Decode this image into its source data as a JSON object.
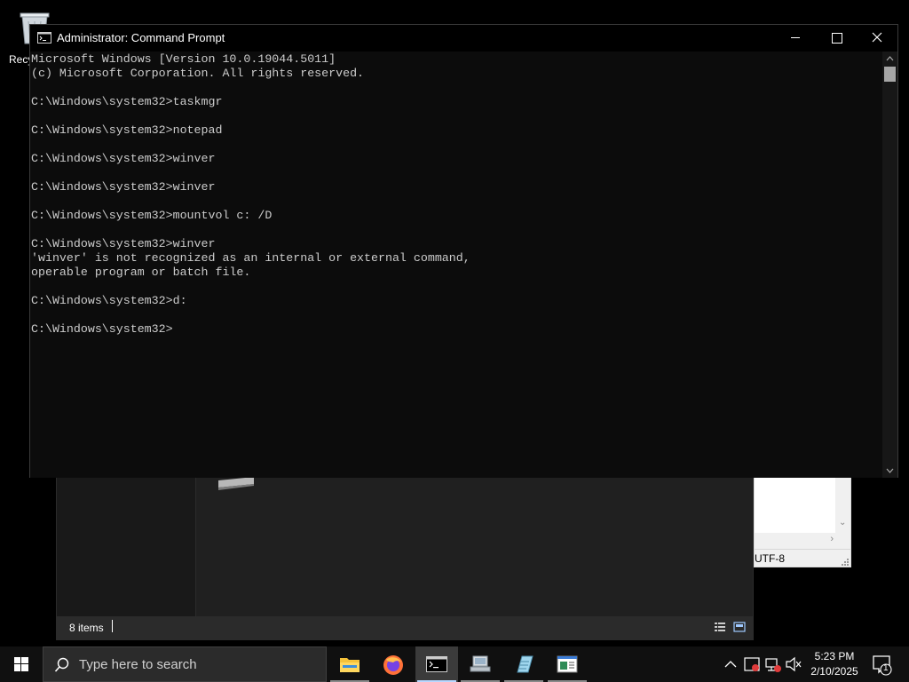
{
  "desktop": {
    "recycle_bin_label": "Recy"
  },
  "cmd": {
    "title": "Administrator: Command Prompt",
    "lines": [
      "Microsoft Windows [Version 10.0.19044.5011]",
      "(c) Microsoft Corporation. All rights reserved.",
      "",
      "C:\\Windows\\system32>taskmgr",
      "",
      "C:\\Windows\\system32>notepad",
      "",
      "C:\\Windows\\system32>winver",
      "",
      "C:\\Windows\\system32>winver",
      "",
      "C:\\Windows\\system32>mountvol c: /D",
      "",
      "C:\\Windows\\system32>winver",
      "'winver' is not recognized as an internal or external command,",
      "operable program or batch file.",
      "",
      "C:\\Windows\\system32>d:",
      "",
      "C:\\Windows\\system32>"
    ]
  },
  "explorer": {
    "status_items": "8 items"
  },
  "notepad": {
    "encoding": "UTF-8"
  },
  "taskbar": {
    "search_placeholder": "Type here to search",
    "apps": [
      {
        "name": "File Explorer",
        "icon": "file-explorer-icon"
      },
      {
        "name": "Firefox",
        "icon": "firefox-icon"
      },
      {
        "name": "Command Prompt",
        "icon": "cmd-icon",
        "active": true
      },
      {
        "name": "Network",
        "icon": "network-app-icon"
      },
      {
        "name": "Notepad",
        "icon": "notepad-icon"
      },
      {
        "name": "Window",
        "icon": "window-app-icon"
      }
    ],
    "clock": {
      "time": "5:23 PM",
      "date": "2/10/2025"
    },
    "notification_count": "1"
  }
}
